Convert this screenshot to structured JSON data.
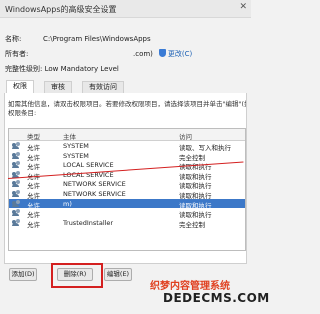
{
  "window": {
    "title": "WindowsApps的高级安全设置",
    "close_glyph": "✕"
  },
  "info": {
    "name_label": "名称:",
    "name_value": "C:\\Program Files\\WindowsApps",
    "owner_label": "所有者:",
    "owner_value": ".com)",
    "change_link": "更改(C)",
    "integrity_label": "完整性级别: Low Mandatory Level"
  },
  "tabs": [
    {
      "label": "权限"
    },
    {
      "label": "审核"
    },
    {
      "label": "有效访问"
    }
  ],
  "description": "如需其他信息，请双击权限项目。若要修改权限项目，请选择该项目并单击\"编辑\"(如果可用)。",
  "list_title": "权限条目:",
  "grid": {
    "headers": {
      "type": "类型",
      "principal": "主体",
      "access": "访问"
    },
    "rows": [
      {
        "type": "允许",
        "principal": "SYSTEM",
        "access": "读取、写入和执行"
      },
      {
        "type": "允许",
        "principal": "SYSTEM",
        "access": "完全控制"
      },
      {
        "type": "允许",
        "principal": "LOCAL SERVICE",
        "access": "读取和执行"
      },
      {
        "type": "允许",
        "principal": "LOCAL SERVICE",
        "access": "读取和执行"
      },
      {
        "type": "允许",
        "principal": "NETWORK SERVICE",
        "access": "读取和执行"
      },
      {
        "type": "允许",
        "principal": "NETWORK SERVICE",
        "access": "读取和执行"
      },
      {
        "type": "允许",
        "principal": "m)",
        "access": "读取和执行",
        "selected": true
      },
      {
        "type": "允许",
        "principal": "",
        "access": "读取和执行"
      },
      {
        "type": "允许",
        "principal": "TrustedInstaller",
        "access": "完全控制"
      }
    ]
  },
  "buttons": {
    "add": "添加(D)",
    "remove": "删除(R)",
    "edit": "编辑(E)"
  },
  "watermark": {
    "line1": "织梦内容管理系统",
    "line2": "DEDECMS.COM"
  },
  "colors": {
    "selection": "#3c78c8",
    "annotation_red": "#d42020"
  }
}
